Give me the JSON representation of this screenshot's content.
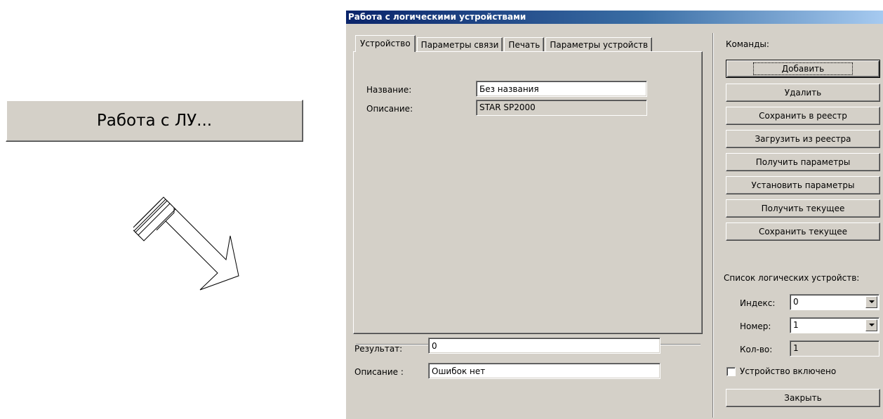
{
  "launch_button": {
    "label": "Работа с ЛУ..."
  },
  "dialog": {
    "title": "Работа с логическими устройствами",
    "tabs": [
      {
        "label": "Устройство",
        "active": true
      },
      {
        "label": "Параметры связи",
        "active": false
      },
      {
        "label": "Печать",
        "active": false
      },
      {
        "label": "Параметры устройств",
        "active": false
      }
    ],
    "device": {
      "name_label": "Название:",
      "name_value": "Без названия",
      "description_label": "Описание:",
      "description_value": "STAR SP2000"
    },
    "result": {
      "result_label": "Результат:",
      "result_value": "0",
      "description_label": "Описание :",
      "description_value": "Ошибок нет"
    },
    "commands": {
      "header": "Команды:",
      "buttons": [
        "Добавить",
        "Удалить",
        "Сохранить в реестр",
        "Загрузить из реестра",
        "Получить параметры",
        "Установить параметры",
        "Получить текущее",
        "Сохранить текущее"
      ]
    },
    "device_list": {
      "header": "Список логических устройств:",
      "index_label": "Индекс:",
      "index_value": "0",
      "number_label": "Номер:",
      "number_value": "1",
      "count_label": "Кол-во:",
      "count_value": "1",
      "enabled_label": "Устройство включено",
      "enabled_checked": false
    },
    "close_button": "Закрыть"
  }
}
